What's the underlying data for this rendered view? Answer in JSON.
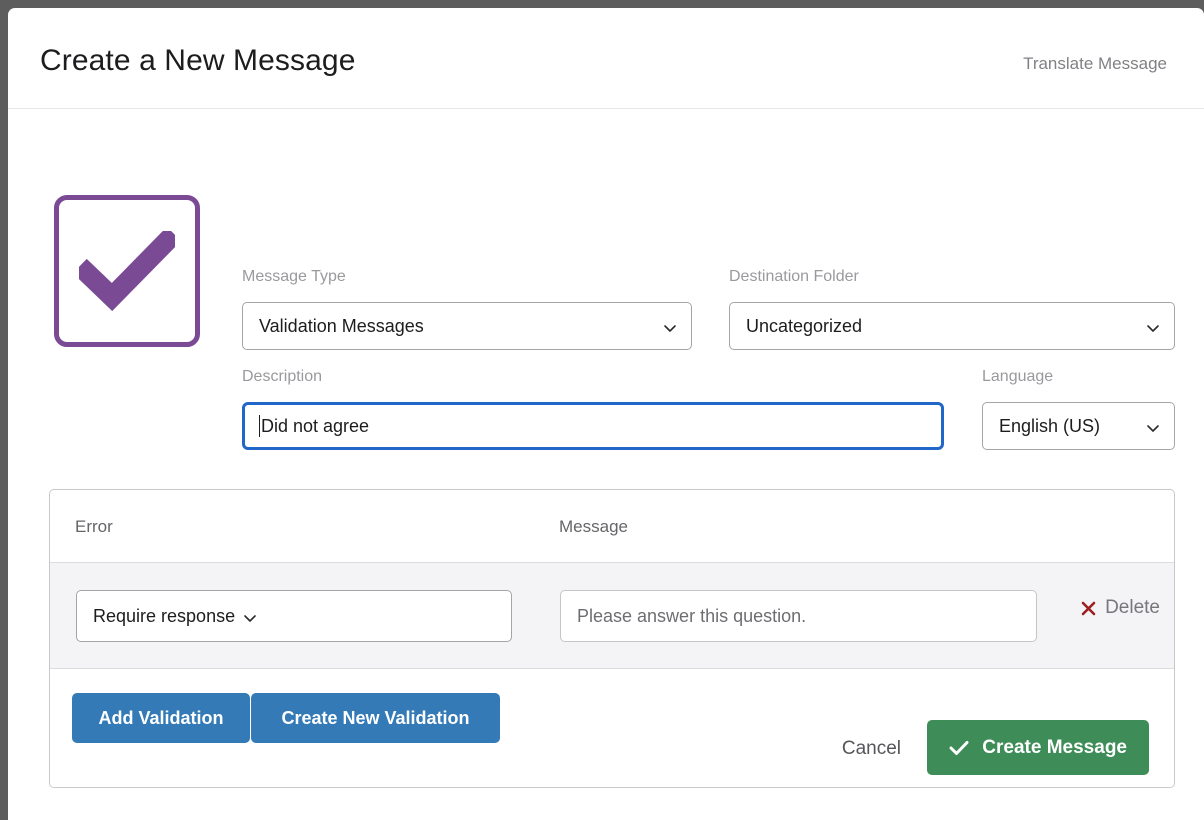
{
  "header": {
    "title": "Create a New Message",
    "translate_label": "Translate Message"
  },
  "icon_tile": {
    "name": "checkmark-tile",
    "icon": "check-icon",
    "border_color": "#7a4a95",
    "check_color": "#7a4a95"
  },
  "form": {
    "message_type": {
      "label": "Message Type",
      "value": "Validation Messages"
    },
    "destination_folder": {
      "label": "Destination Folder",
      "value": "Uncategorized"
    },
    "description": {
      "label": "Description",
      "value": "Did not agree",
      "placeholder": "",
      "focused": true,
      "focus_color": "#2067c9"
    },
    "language": {
      "label": "Language",
      "value": "English (US)"
    }
  },
  "validations_table": {
    "columns": [
      "Error",
      "Message"
    ],
    "rows": [
      {
        "error": "Require response",
        "message_value": "",
        "message_placeholder": "Please answer this question.",
        "delete_label": "Delete",
        "delete_icon": "x-icon",
        "delete_icon_color": "#9c2020"
      }
    ],
    "actions": {
      "add_validation_label": "Add Validation",
      "create_new_validation_label": "Create New Validation",
      "button_color": "#337ab7"
    }
  },
  "footer": {
    "cancel_label": "Cancel",
    "create_label": "Create Message",
    "create_icon": "check-icon",
    "create_color": "#3e8c57"
  }
}
